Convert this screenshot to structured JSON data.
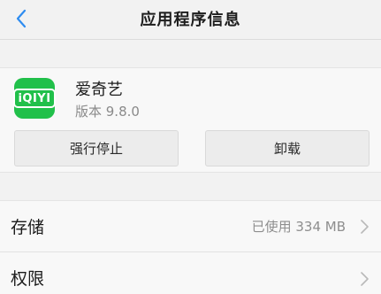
{
  "nav": {
    "title": "应用程序信息",
    "back_icon": "chevron-left-icon",
    "accent_color": "#2e8cf0"
  },
  "app": {
    "name": "爱奇艺",
    "version": "版本 9.8.0",
    "icon_text": "iQIYI",
    "icon_color": "#21c04a"
  },
  "actions": {
    "force_stop_label": "强行停止",
    "uninstall_label": "卸载"
  },
  "settings": {
    "storage": {
      "label": "存储",
      "value": "已使用 334 MB"
    },
    "permissions": {
      "label": "权限"
    }
  }
}
